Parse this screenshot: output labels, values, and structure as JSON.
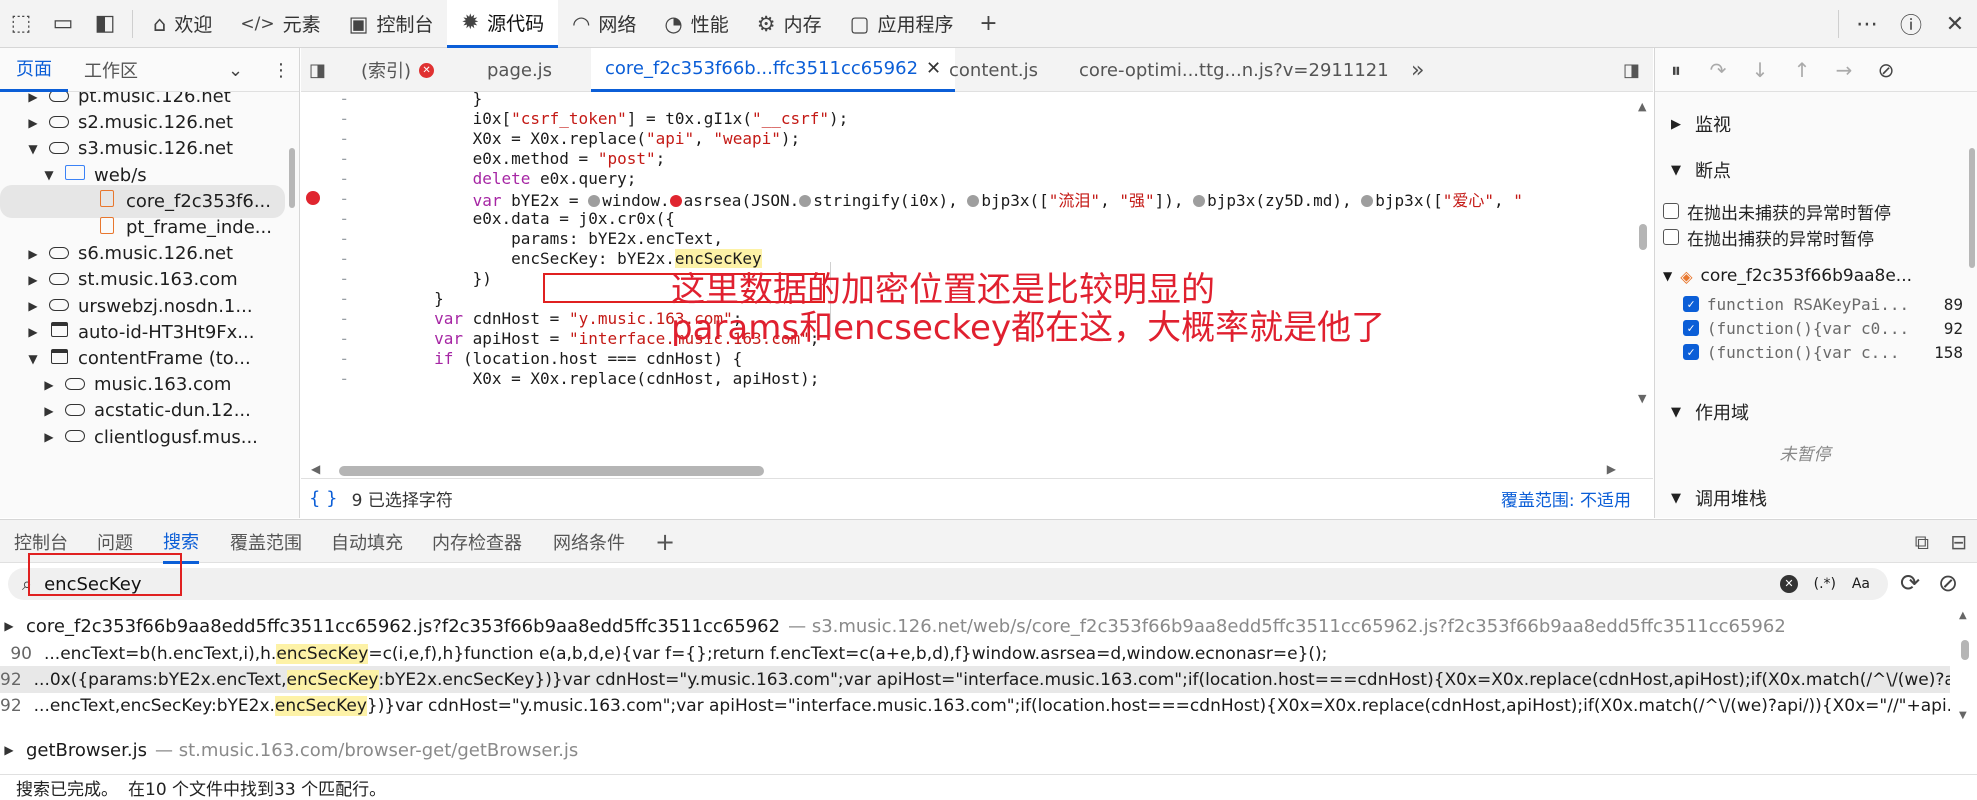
{
  "toolbar": {
    "tabs": [
      {
        "icon": "home-icon",
        "label": "欢迎"
      },
      {
        "icon": "code-icon",
        "label": "元素"
      },
      {
        "icon": "console-icon",
        "label": "控制台"
      },
      {
        "icon": "bug-icon",
        "label": "源代码"
      },
      {
        "icon": "wifi-icon",
        "label": "网络"
      },
      {
        "icon": "gauge-icon",
        "label": "性能"
      },
      {
        "icon": "gear-icon",
        "label": "内存"
      },
      {
        "icon": "window-icon",
        "label": "应用程序"
      }
    ],
    "active_tab": "源代码"
  },
  "navigator": {
    "tabs": [
      "页面",
      "工作区"
    ],
    "tree": [
      {
        "label": "pt.music.126.net",
        "icon": "cloud-icon",
        "arrow": "▶"
      },
      {
        "label": "s2.music.126.net",
        "icon": "cloud-icon",
        "arrow": "▶"
      },
      {
        "label": "s3.music.126.net",
        "icon": "cloud-icon",
        "arrow": "▼"
      },
      {
        "label": "web/s",
        "icon": "folder-icon",
        "arrow": "▼"
      },
      {
        "label": "core_f2c353f6...",
        "icon": "file-icon",
        "arrow": ""
      },
      {
        "label": "pt_frame_inde...",
        "icon": "file-icon",
        "arrow": ""
      },
      {
        "label": "s6.music.126.net",
        "icon": "cloud-icon",
        "arrow": "▶"
      },
      {
        "label": "st.music.163.com",
        "icon": "cloud-icon",
        "arrow": "▶"
      },
      {
        "label": "urswebzj.nosdn.1...",
        "icon": "cloud-icon",
        "arrow": "▶"
      },
      {
        "label": "auto-id-HT3Ht9Fx...",
        "icon": "window-icon",
        "arrow": "▶"
      },
      {
        "label": "contentFrame (to...",
        "icon": "window-icon",
        "arrow": "▼"
      },
      {
        "label": "music.163.com",
        "icon": "cloud-icon",
        "arrow": "▶"
      },
      {
        "label": "acstatic-dun.12...",
        "icon": "cloud-icon",
        "arrow": "▶"
      },
      {
        "label": "clientlogusf.mus...",
        "icon": "cloud-icon",
        "arrow": "▶"
      }
    ]
  },
  "editor": {
    "tabs": [
      "(索引)",
      "page.js",
      "core_f2c353f66b...ffc3511cc65962",
      "content.js",
      "core-optimi...ttg...n.js?v=2911121"
    ],
    "active_tab": "core_f2c353f66b...ffc3511cc65962",
    "code": [
      {
        "gut": "-",
        "html": "            }"
      },
      {
        "gut": "-",
        "html": "            i0x[<span class='str'>\"csrf_token\"</span>] = t0x.gI1x(<span class='str'>\"__csrf\"</span>);"
      },
      {
        "gut": "-",
        "html": "            X0x = X0x.replace(<span class='str'>\"api\"</span>, <span class='str'>\"weapi\"</span>);"
      },
      {
        "gut": "-",
        "html": "            e0x.method = <span class='str'>\"post\"</span>;"
      },
      {
        "gut": "-",
        "html": "            <span class='kw'>delete</span> e0x.query;"
      },
      {
        "gut": "-",
        "html": "            <span class='kw'>var</span> bYE2x = <span class='grey-dot'></span>window.<span class='red-dot'></span>asrsea(JSON.<span class='grey-dot'></span>stringify(i0x), <span class='grey-dot'></span>bjp3x([<span class='str'>\"流泪\"</span>, <span class='str'>\"强\"</span>]), <span class='grey-dot'></span>bjp3x(zy5D.md), <span class='grey-dot'></span>bjp3x([<span class='str'>\"爱心\"</span>, <span class='str'>\"</span>"
      },
      {
        "gut": "-",
        "html": "            e0x.data = j0x.cr0x({"
      },
      {
        "gut": "-",
        "html": "                params: bYE2x.encText,"
      },
      {
        "gut": "-",
        "html": "                encSecKey: bYE2x.<span class='hl'>encSecKey</span>"
      },
      {
        "gut": "-",
        "html": "            })"
      },
      {
        "gut": "-",
        "html": "        }"
      },
      {
        "gut": "-",
        "html": "        <span class='kw'>var</span> cdnHost = <span class='str'>\"y.music.163.com\"</span>;"
      },
      {
        "gut": "-",
        "html": "        <span class='kw'>var</span> apiHost = <span class='str'>\"interface.music.163.com\"</span>;"
      },
      {
        "gut": "-",
        "html": "        <span class='kw'>if</span> (location.host === cdnHost) {"
      },
      {
        "gut": "-",
        "html": "            X0x = X0x.replace(cdnHost, apiHost);"
      }
    ],
    "annotation_line1": "这里数据的加密位置还是比较明显的",
    "annotation_line2": "params和encseckey都在这，大概率就是他了",
    "status_left": "9 已选择字符",
    "status_right": "覆盖范围: 不适用"
  },
  "debugger": {
    "sections": {
      "watch": "监视",
      "breakpoints": "断点",
      "scope": "作用域",
      "callstack": "调用堆栈"
    },
    "exception_uncaught": "在抛出未捕获的异常时暂停",
    "exception_caught": "在抛出捕获的异常时暂停",
    "bp_file": "core_f2c353f66b9aa8e...",
    "bps": [
      {
        "fn": "function RSAKeyPai...",
        "line": "89"
      },
      {
        "fn": "(function(){var c0...",
        "line": "92"
      },
      {
        "fn": "(function(){var c...",
        "line": "158"
      }
    ],
    "not_paused": "未暂停"
  },
  "drawer": {
    "tabs": [
      "控制台",
      "问题",
      "搜索",
      "覆盖范围",
      "自动填充",
      "内存检查器",
      "网络条件"
    ],
    "active_tab": "搜索"
  },
  "search": {
    "query": "encSecKey",
    "regex_label": "(.*)",
    "case_label": "Aa"
  },
  "results": {
    "files": [
      {
        "name": "core_f2c353f66b9aa8edd5ffc3511cc65962.js?f2c353f66b9aa8edd5ffc3511cc65962",
        "path": "s3.music.126.net/web/s/core_f2c353f66b9aa8edd5ffc3511cc65962.js?f2c353f66b9aa8edd5ffc3511cc65962"
      },
      {
        "name": "getBrowser.js",
        "path": "st.music.163.com/browser-get/getBrowser.js"
      }
    ],
    "lines": [
      {
        "no": "90",
        "pre": "...encText=b(h.encText,i),h.",
        "match": "encSecKey",
        "post": "=c(i,e,f),h}function e(a,b,d,e){var f={};return f.encText=c(a+e,b,d),f}window.asrsea=d,window.ecnonasr=e}();"
      },
      {
        "no": "92",
        "pre": "...0x({params:bYE2x.encText,",
        "match": "encSecKey",
        "post": ":bYE2x.encSecKey})}var cdnHost=\"y.music.163.com\";var apiHost=\"interface.music.163.com\";if(location.host===cdnHost){X0x=X0x.replace(cdnHost,apiHost);if(X0x.match(/^\\/(we)?a..."
      },
      {
        "no": "92",
        "pre": "...encText,encSecKey:bYE2x.",
        "match": "encSecKey",
        "post": "})}var cdnHost=\"y.music.163.com\";var apiHost=\"interface.music.163.com\";if(location.host===cdnHost){X0x=X0x.replace(cdnHost,apiHost);if(X0x.match(/^\\/(we)?api/)){X0x=\"//\"+api..."
      }
    ]
  },
  "status": {
    "done": "搜索已完成。",
    "summary": "在10 个文件中找到33 个匹配行。"
  }
}
